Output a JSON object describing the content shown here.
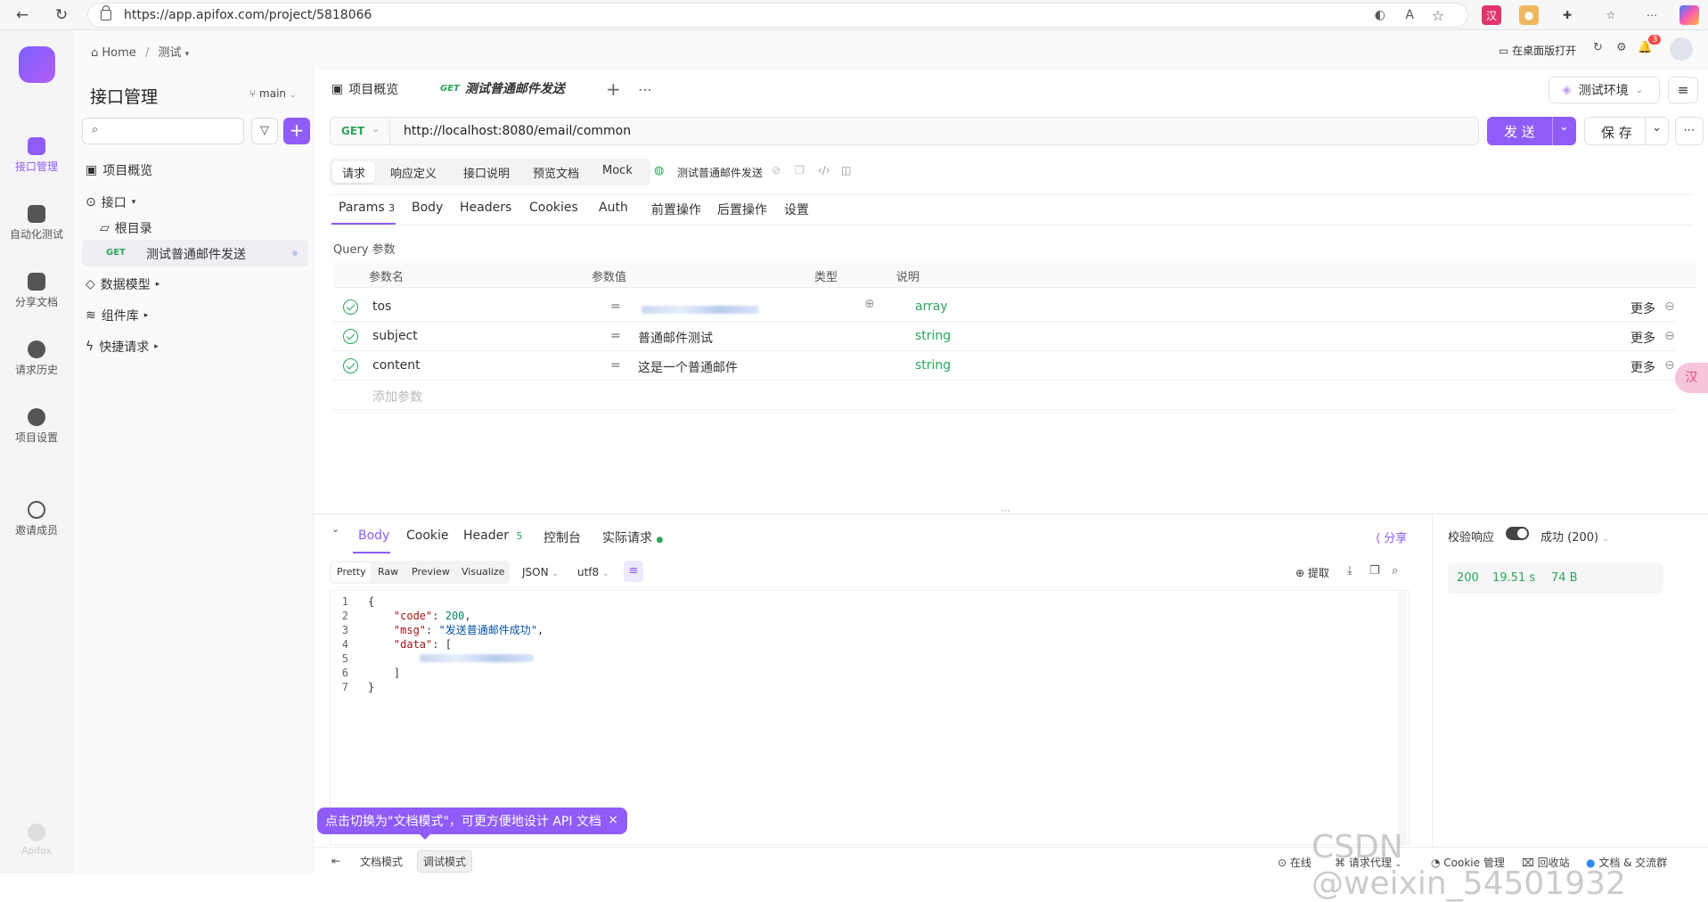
{
  "browser": {
    "url": "https://app.apifox.com/project/5818066"
  },
  "rail": {
    "items": [
      {
        "label": "接口管理",
        "icon": "api-icon"
      },
      {
        "label": "自动化测试",
        "icon": "automation-icon"
      },
      {
        "label": "分享文档",
        "icon": "share-doc-icon"
      },
      {
        "label": "请求历史",
        "icon": "history-icon"
      },
      {
        "label": "项目设置",
        "icon": "settings-icon"
      },
      {
        "label": "邀请成员",
        "icon": "invite-icon"
      }
    ],
    "brand": "Apifox"
  },
  "topnav": {
    "home": "Home",
    "project": "测试",
    "open_desktop": "在桌面版打开",
    "notif_count": "3"
  },
  "left": {
    "title": "接口管理",
    "branch": "main",
    "tree": {
      "overview": "项目概览",
      "apis": "接口",
      "root": "根目录",
      "api_method": "GET",
      "api_name": "测试普通邮件发送",
      "models": "数据模型",
      "components": "组件库",
      "quick": "快捷请求"
    }
  },
  "tabs": {
    "overview": "项目概览",
    "active_method": "GET",
    "active_name": "测试普通邮件发送",
    "env": "测试环境"
  },
  "request": {
    "method": "GET",
    "url": "http://localhost:8080/email/common",
    "send": "发 送",
    "save": "保 存",
    "modes": [
      "请求",
      "响应定义",
      "接口说明",
      "预览文档",
      "Mock"
    ],
    "name": "测试普通邮件发送",
    "subtabs": [
      "Params",
      "Body",
      "Headers",
      "Cookies",
      "Auth",
      "前置操作",
      "后置操作",
      "设置"
    ],
    "params_count": "3",
    "query_title": "Query 参数",
    "columns": [
      "参数名",
      "参数值",
      "类型",
      "说明"
    ],
    "params": [
      {
        "name": "tos",
        "value": "",
        "type": "array"
      },
      {
        "name": "subject",
        "value": "普通邮件测试",
        "type": "string"
      },
      {
        "name": "content",
        "value": "这是一个普通邮件",
        "type": "string"
      }
    ],
    "more": "更多",
    "add_param": "添加参数"
  },
  "response": {
    "tabs": [
      "Body",
      "Cookie",
      "Header",
      "控制台",
      "实际请求"
    ],
    "header_count": "5",
    "share": "分享",
    "views": [
      "Pretty",
      "Raw",
      "Preview",
      "Visualize"
    ],
    "format": "JSON",
    "encoding": "utf8",
    "extract": "提取",
    "validate": "校验响应",
    "status_select": "成功 (200)",
    "status": "200",
    "time": "19.51 s",
    "size": "74 B",
    "lines": [
      "1",
      "2",
      "3",
      "4",
      "5",
      "6",
      "7"
    ],
    "code_key": "\"code\"",
    "code_val": "200",
    "msg_key": "\"msg\"",
    "msg_val": "\"发送普通邮件成功\"",
    "data_key": "\"data\""
  },
  "bottom": {
    "tooltip": "点击切换为\"文档模式\"，可更方便地设计 API 文档",
    "doc_mode": "文档模式",
    "debug_mode": "调试模式",
    "online": "在线",
    "proxy": "请求代理",
    "cookie": "Cookie 管理",
    "trash": "回收站",
    "community": "文档 & 交流群"
  },
  "watermark": "CSDN @weixin_54501932",
  "colors": {
    "accent": "#8f5cf7",
    "success": "#2ca65a"
  }
}
